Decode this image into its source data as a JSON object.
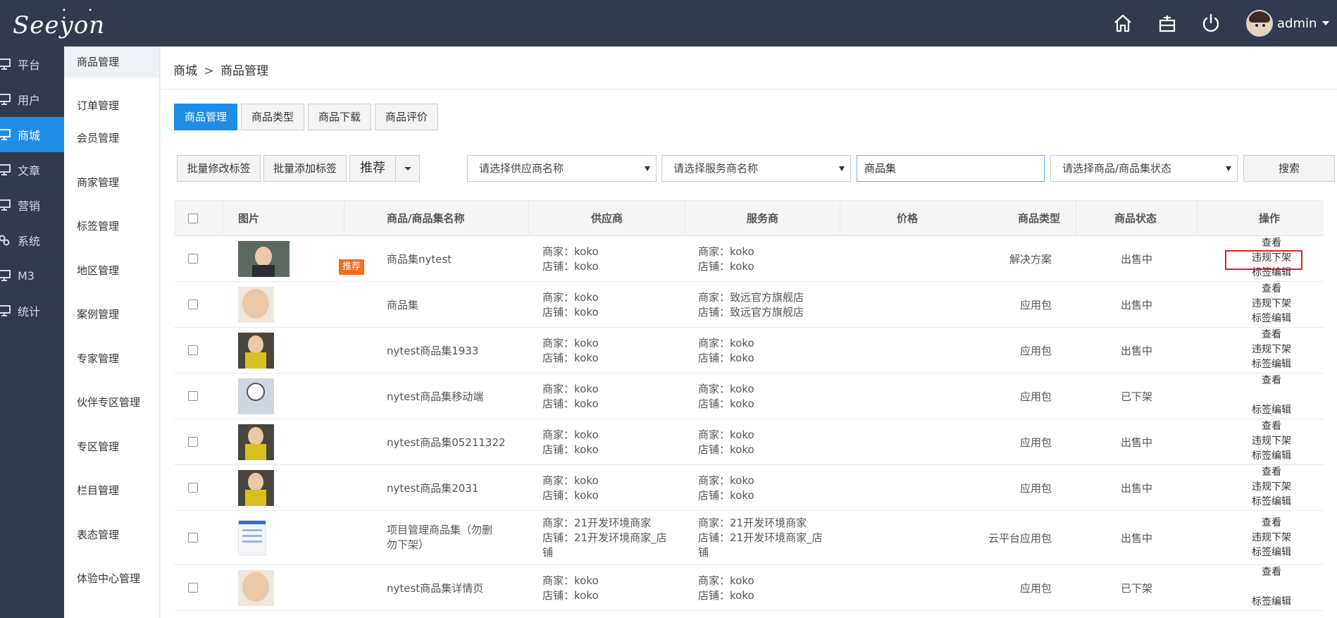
{
  "brand": {
    "logo_text": "Seeyon"
  },
  "header": {
    "user_name": "admin"
  },
  "nav_primary": [
    {
      "label": "平台",
      "active": false
    },
    {
      "label": "用户",
      "active": false
    },
    {
      "label": "商城",
      "active": true
    },
    {
      "label": "文章",
      "active": false
    },
    {
      "label": "营销",
      "active": false
    },
    {
      "label": "系统",
      "active": false
    },
    {
      "label": "M3",
      "active": false
    },
    {
      "label": "统计",
      "active": false
    }
  ],
  "nav_secondary": [
    {
      "label": "商品管理",
      "active": true
    },
    {
      "label": "订单管理"
    },
    {
      "label": "会员管理"
    },
    {
      "label": "商家管理"
    },
    {
      "label": "标签管理"
    },
    {
      "label": "地区管理"
    },
    {
      "label": "案例管理"
    },
    {
      "label": "专家管理"
    },
    {
      "label": "伙伴专区管理"
    },
    {
      "label": "专区管理"
    },
    {
      "label": "栏目管理"
    },
    {
      "label": "表态管理"
    },
    {
      "label": "体验中心管理"
    }
  ],
  "breadcrumb": {
    "parent": "商城",
    "separator": ">",
    "current": "商品管理"
  },
  "tabs": [
    "商品管理",
    "商品类型",
    "商品下载",
    "商品评价"
  ],
  "toolbar": {
    "batch_edit_tags": "批量修改标签",
    "batch_add_tags": "批量添加标签",
    "recommend": "推荐",
    "supplier_select": "请选择供应商名称",
    "service_select": "请选择服务商名称",
    "search_value": "商品集",
    "status_select": "请选择商品/商品集状态",
    "search_button": "搜索"
  },
  "table": {
    "headers": {
      "image": "图片",
      "name": "商品/商品集名称",
      "supplier": "供应商",
      "service": "服务商",
      "price": "价格",
      "type": "商品类型",
      "status": "商品状态",
      "ops": "操作"
    },
    "rows": [
      {
        "name": "商品集nytest",
        "badge": "推荐",
        "sup_merchant": "商家：koko",
        "sup_shop": "店铺：koko",
        "svc_merchant": "商家：koko",
        "svc_shop": "店铺：koko",
        "price": "",
        "type": "解决方案",
        "status": "出售中",
        "op_view": "查看",
        "op_off": "违规下架",
        "op_tag": "标签编辑"
      },
      {
        "name": "商品集",
        "badge": "",
        "sup_merchant": "商家：koko",
        "sup_shop": "店铺：koko",
        "svc_merchant": "商家：致远官方旗舰店",
        "svc_shop": "店铺：致远官方旗舰店",
        "price": "",
        "type": "应用包",
        "status": "出售中",
        "op_view": "查看",
        "op_off": "违规下架",
        "op_tag": "标签编辑"
      },
      {
        "name": "nytest商品集1933",
        "badge": "",
        "sup_merchant": "商家：koko",
        "sup_shop": "店铺：koko",
        "svc_merchant": "商家：koko",
        "svc_shop": "店铺：koko",
        "price": "",
        "type": "应用包",
        "status": "出售中",
        "op_view": "查看",
        "op_off": "违规下架",
        "op_tag": "标签编辑"
      },
      {
        "name": "nytest商品集移动端",
        "badge": "",
        "sup_merchant": "商家：koko",
        "sup_shop": "店铺：koko",
        "svc_merchant": "商家：koko",
        "svc_shop": "店铺：koko",
        "price": "",
        "type": "应用包",
        "status": "已下架",
        "op_view": "查看",
        "op_off": "",
        "op_tag": "标签编辑"
      },
      {
        "name": "nytest商品集05211322",
        "badge": "",
        "sup_merchant": "商家：koko",
        "sup_shop": "店铺：koko",
        "svc_merchant": "商家：koko",
        "svc_shop": "店铺：koko",
        "price": "",
        "type": "应用包",
        "status": "出售中",
        "op_view": "查看",
        "op_off": "违规下架",
        "op_tag": "标签编辑"
      },
      {
        "name": "nytest商品集2031",
        "badge": "",
        "sup_merchant": "商家：koko",
        "sup_shop": "店铺：koko",
        "svc_merchant": "商家：koko",
        "svc_shop": "店铺：koko",
        "price": "",
        "type": "应用包",
        "status": "出售中",
        "op_view": "查看",
        "op_off": "违规下架",
        "op_tag": "标签编辑"
      },
      {
        "name": "项目管理商品集（勿删勿下架）",
        "badge": "",
        "sup_merchant": "商家：21开发环境商家",
        "sup_shop": "店铺：21开发环境商家_店铺",
        "svc_merchant": "商家：21开发环境商家",
        "svc_shop": "店铺：21开发环境商家_店铺",
        "price": "",
        "type": "云平台应用包",
        "status": "出售中",
        "op_view": "查看",
        "op_off": "违规下架",
        "op_tag": "标签编辑"
      },
      {
        "name": "nytest商品集详情页",
        "badge": "",
        "sup_merchant": "商家：koko",
        "sup_shop": "店铺：koko",
        "svc_merchant": "商家：koko",
        "svc_shop": "店铺：koko",
        "price": "",
        "type": "应用包",
        "status": "已下架",
        "op_view": "查看",
        "op_off": "",
        "op_tag": "标签编辑"
      }
    ]
  },
  "colors": {
    "header_bg": "#333a4d",
    "accent": "#1f8ce6",
    "badge": "#f36c1f",
    "highlight": "#e02020"
  }
}
